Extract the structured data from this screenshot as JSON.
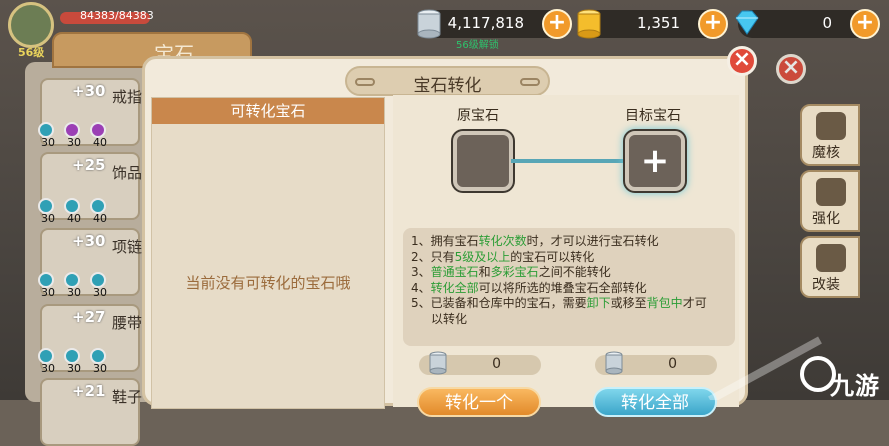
{
  "hud": {
    "hp_text": "84383/84383",
    "level_text": "56级",
    "resources": [
      {
        "name": "silver",
        "icon": "silver-coins-icon",
        "value": "4,117,818"
      },
      {
        "name": "gold",
        "icon": "gold-coins-icon",
        "value": "1,351"
      },
      {
        "name": "diamond",
        "icon": "diamond-icon",
        "value": "0"
      }
    ],
    "sub_label": "56级解锁"
  },
  "background": {
    "panel_title": "宝石",
    "items": [
      {
        "level": "+30",
        "label": "戒指",
        "slots": [
          "30",
          "30",
          "40"
        ]
      },
      {
        "level": "+25",
        "label": "饰品",
        "slots": [
          "30",
          "40",
          "40"
        ]
      },
      {
        "level": "+30",
        "label": "项链",
        "slots": [
          "30",
          "30",
          "30"
        ]
      },
      {
        "level": "+27",
        "label": "腰带",
        "slots": [
          "30",
          "30",
          "30"
        ]
      },
      {
        "level": "+21",
        "label": "鞋子",
        "slots": []
      }
    ]
  },
  "side_menu": [
    {
      "label": "魔核",
      "icon": "magic-core-icon"
    },
    {
      "label": "强化",
      "icon": "enhance-icon"
    },
    {
      "label": "改装",
      "icon": "anvil-icon"
    }
  ],
  "dialog": {
    "title": "宝石转化",
    "source_header": "可转化宝石",
    "empty_text": "当前没有可转化的宝石哦",
    "original_label": "原宝石",
    "target_label": "目标宝石",
    "target_plus": "+",
    "rules": [
      {
        "pre": "1、拥有宝石",
        "hl": "转化次数",
        "post": "时，才可以进行宝石转化"
      },
      {
        "pre": "2、只有",
        "hl": "5级及以上",
        "post": "的宝石可以转化"
      },
      {
        "pre": "3、",
        "hl": "普通宝石",
        "mid": "和",
        "hl2": "多彩宝石",
        "post": "之间不能转化"
      },
      {
        "pre": "4、",
        "hl": "转化全部",
        "post": "可以将所选的堆叠宝石全部转化"
      },
      {
        "pre": "5、已装备和仓库中的宝石，需要",
        "hl": "卸下",
        "mid": "或移至",
        "hl2": "背包中",
        "post": "才可"
      },
      {
        "pre": "",
        "hl": "",
        "post": "以转化"
      }
    ],
    "count_left": "0",
    "count_right": "0",
    "btn_convert_one": "转化一个",
    "btn_convert_all": "转化全部"
  },
  "watermark": "九游",
  "colors": {
    "accent_orange": "#c9874c",
    "highlight_green": "#2c9d36",
    "close_red": "#e04a3a"
  }
}
